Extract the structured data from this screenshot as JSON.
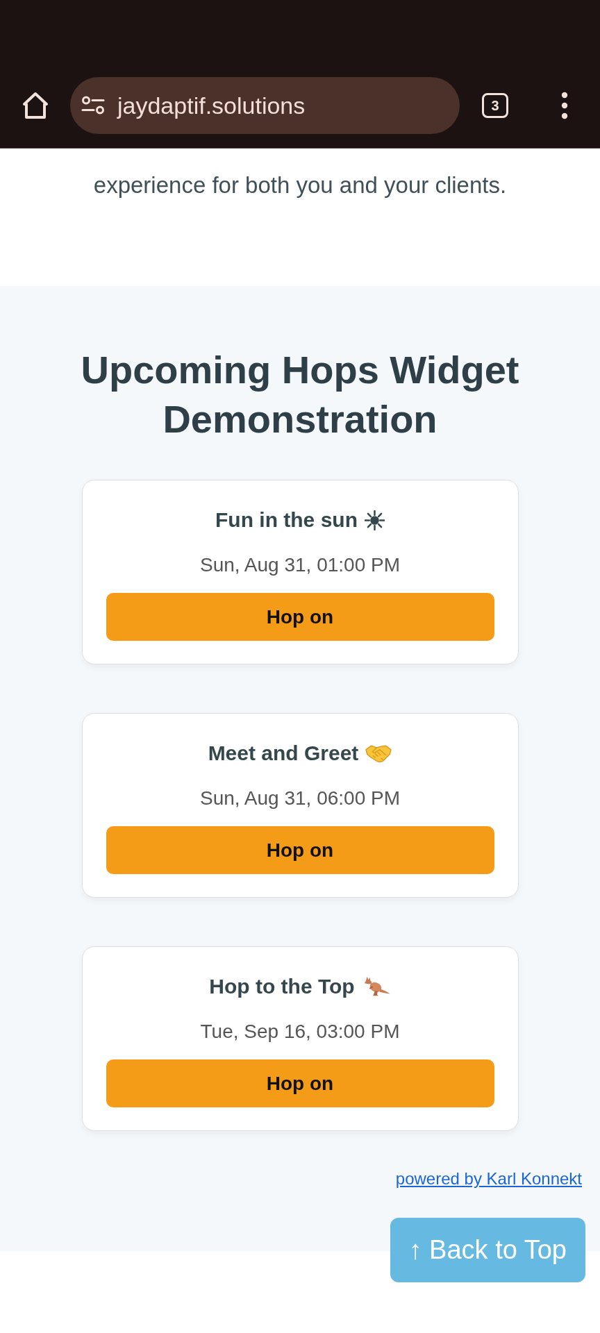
{
  "browser": {
    "url": "jaydaptif.solutions",
    "tab_count": "3"
  },
  "intro": {
    "text": "experience for both you and your clients."
  },
  "demo": {
    "heading": "Upcoming Hops Widget Demonstration",
    "events": [
      {
        "title": "Fun in the sun",
        "kind": "sun",
        "date": "Sun, Aug 31, 01:00 PM",
        "button": "Hop on"
      },
      {
        "title": "Meet and Greet",
        "kind": "handshake",
        "date": "Sun, Aug 31, 06:00 PM",
        "button": "Hop on"
      },
      {
        "title": "Hop to the Top",
        "kind": "kangaroo",
        "date": "Tue, Sep 16, 03:00 PM",
        "button": "Hop on"
      }
    ],
    "powered_by": "powered by Karl Konnekt"
  },
  "back_to_top": "↑ Back to Top"
}
